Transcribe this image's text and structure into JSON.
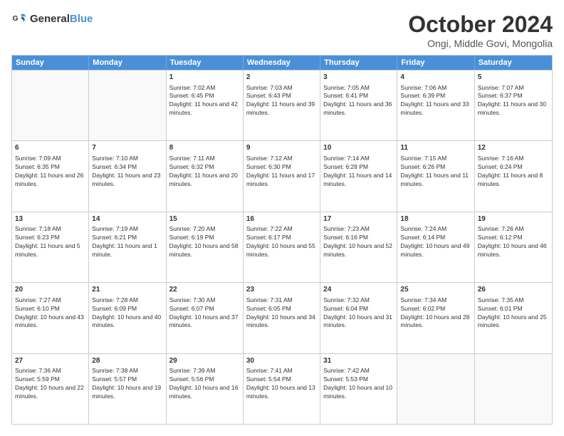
{
  "header": {
    "logo_general": "General",
    "logo_blue": "Blue",
    "title": "October 2024",
    "location": "Ongi, Middle Govi, Mongolia"
  },
  "days_of_week": [
    "Sunday",
    "Monday",
    "Tuesday",
    "Wednesday",
    "Thursday",
    "Friday",
    "Saturday"
  ],
  "weeks": [
    [
      {
        "day": "",
        "text": ""
      },
      {
        "day": "",
        "text": ""
      },
      {
        "day": "1",
        "text": "Sunrise: 7:02 AM\nSunset: 6:45 PM\nDaylight: 11 hours and 42 minutes."
      },
      {
        "day": "2",
        "text": "Sunrise: 7:03 AM\nSunset: 6:43 PM\nDaylight: 11 hours and 39 minutes."
      },
      {
        "day": "3",
        "text": "Sunrise: 7:05 AM\nSunset: 6:41 PM\nDaylight: 11 hours and 36 minutes."
      },
      {
        "day": "4",
        "text": "Sunrise: 7:06 AM\nSunset: 6:39 PM\nDaylight: 11 hours and 33 minutes."
      },
      {
        "day": "5",
        "text": "Sunrise: 7:07 AM\nSunset: 6:37 PM\nDaylight: 11 hours and 30 minutes."
      }
    ],
    [
      {
        "day": "6",
        "text": "Sunrise: 7:09 AM\nSunset: 6:35 PM\nDaylight: 11 hours and 26 minutes."
      },
      {
        "day": "7",
        "text": "Sunrise: 7:10 AM\nSunset: 6:34 PM\nDaylight: 11 hours and 23 minutes."
      },
      {
        "day": "8",
        "text": "Sunrise: 7:11 AM\nSunset: 6:32 PM\nDaylight: 11 hours and 20 minutes."
      },
      {
        "day": "9",
        "text": "Sunrise: 7:12 AM\nSunset: 6:30 PM\nDaylight: 11 hours and 17 minutes."
      },
      {
        "day": "10",
        "text": "Sunrise: 7:14 AM\nSunset: 6:28 PM\nDaylight: 11 hours and 14 minutes."
      },
      {
        "day": "11",
        "text": "Sunrise: 7:15 AM\nSunset: 6:26 PM\nDaylight: 11 hours and 11 minutes."
      },
      {
        "day": "12",
        "text": "Sunrise: 7:16 AM\nSunset: 6:24 PM\nDaylight: 11 hours and 8 minutes."
      }
    ],
    [
      {
        "day": "13",
        "text": "Sunrise: 7:18 AM\nSunset: 6:23 PM\nDaylight: 11 hours and 5 minutes."
      },
      {
        "day": "14",
        "text": "Sunrise: 7:19 AM\nSunset: 6:21 PM\nDaylight: 11 hours and 1 minute."
      },
      {
        "day": "15",
        "text": "Sunrise: 7:20 AM\nSunset: 6:19 PM\nDaylight: 10 hours and 58 minutes."
      },
      {
        "day": "16",
        "text": "Sunrise: 7:22 AM\nSunset: 6:17 PM\nDaylight: 10 hours and 55 minutes."
      },
      {
        "day": "17",
        "text": "Sunrise: 7:23 AM\nSunset: 6:16 PM\nDaylight: 10 hours and 52 minutes."
      },
      {
        "day": "18",
        "text": "Sunrise: 7:24 AM\nSunset: 6:14 PM\nDaylight: 10 hours and 49 minutes."
      },
      {
        "day": "19",
        "text": "Sunrise: 7:26 AM\nSunset: 6:12 PM\nDaylight: 10 hours and 46 minutes."
      }
    ],
    [
      {
        "day": "20",
        "text": "Sunrise: 7:27 AM\nSunset: 6:10 PM\nDaylight: 10 hours and 43 minutes."
      },
      {
        "day": "21",
        "text": "Sunrise: 7:28 AM\nSunset: 6:09 PM\nDaylight: 10 hours and 40 minutes."
      },
      {
        "day": "22",
        "text": "Sunrise: 7:30 AM\nSunset: 6:07 PM\nDaylight: 10 hours and 37 minutes."
      },
      {
        "day": "23",
        "text": "Sunrise: 7:31 AM\nSunset: 6:05 PM\nDaylight: 10 hours and 34 minutes."
      },
      {
        "day": "24",
        "text": "Sunrise: 7:32 AM\nSunset: 6:04 PM\nDaylight: 10 hours and 31 minutes."
      },
      {
        "day": "25",
        "text": "Sunrise: 7:34 AM\nSunset: 6:02 PM\nDaylight: 10 hours and 28 minutes."
      },
      {
        "day": "26",
        "text": "Sunrise: 7:35 AM\nSunset: 6:01 PM\nDaylight: 10 hours and 25 minutes."
      }
    ],
    [
      {
        "day": "27",
        "text": "Sunrise: 7:36 AM\nSunset: 5:59 PM\nDaylight: 10 hours and 22 minutes."
      },
      {
        "day": "28",
        "text": "Sunrise: 7:38 AM\nSunset: 5:57 PM\nDaylight: 10 hours and 19 minutes."
      },
      {
        "day": "29",
        "text": "Sunrise: 7:39 AM\nSunset: 5:56 PM\nDaylight: 10 hours and 16 minutes."
      },
      {
        "day": "30",
        "text": "Sunrise: 7:41 AM\nSunset: 5:54 PM\nDaylight: 10 hours and 13 minutes."
      },
      {
        "day": "31",
        "text": "Sunrise: 7:42 AM\nSunset: 5:53 PM\nDaylight: 10 hours and 10 minutes."
      },
      {
        "day": "",
        "text": ""
      },
      {
        "day": "",
        "text": ""
      }
    ]
  ]
}
